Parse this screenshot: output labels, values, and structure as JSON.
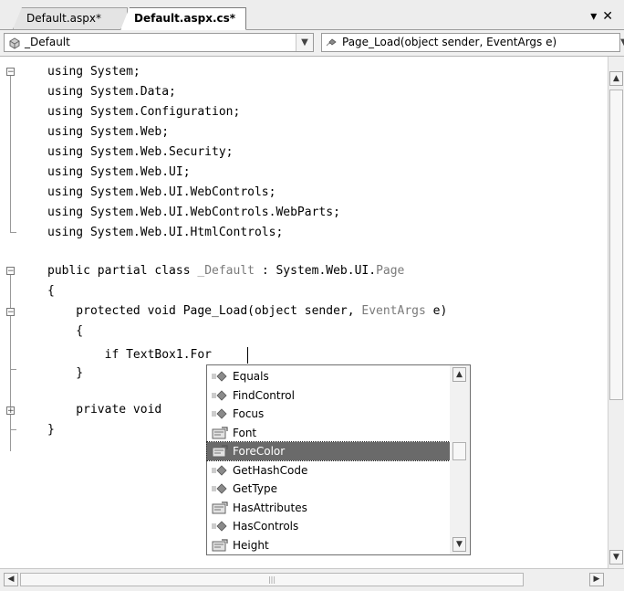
{
  "tabs": [
    {
      "label": "Default.aspx*",
      "active": false
    },
    {
      "label": "Default.aspx.cs*",
      "active": true
    }
  ],
  "tab_controls": {
    "dropdown_glyph": "▾",
    "close_glyph": "✕"
  },
  "navbar": {
    "class_combo": {
      "value": "_Default",
      "icon": "class-icon"
    },
    "member_combo": {
      "value": "Page_Load(object sender, EventArgs e)",
      "icon": "method-icon"
    }
  },
  "code": {
    "lines": [
      "using System;",
      "using System.Data;",
      "using System.Configuration;",
      "using System.Web;",
      "using System.Web.Security;",
      "using System.Web.UI;",
      "using System.Web.UI.WebControls;",
      "using System.Web.UI.WebControls.WebParts;",
      "using System.Web.UI.HtmlControls;",
      "",
      "public partial class _Default : System.Web.UI.Page",
      "{",
      "    protected void Page_Load(object sender, EventArgs e)",
      "    {",
      "        if TextBox1.For",
      "    }",
      "",
      "    private void",
      "}"
    ],
    "class_line": {
      "prefix": "public partial class ",
      "name": "_Default",
      "mid": " : System.Web.UI.",
      "base": "Page"
    },
    "method_line": {
      "prefix": "    protected void Page_Load(object sender, ",
      "type": "EventArgs",
      "suffix": " e)"
    },
    "type_color": "#7a7a7a"
  },
  "intellisense": {
    "items": [
      {
        "label": "Equals",
        "kind": "method-icon",
        "selected": false
      },
      {
        "label": "FindControl",
        "kind": "method-icon",
        "selected": false
      },
      {
        "label": "Focus",
        "kind": "method-icon",
        "selected": false
      },
      {
        "label": "Font",
        "kind": "property-icon",
        "selected": false
      },
      {
        "label": "ForeColor",
        "kind": "property-icon",
        "selected": true
      },
      {
        "label": "GetHashCode",
        "kind": "method-icon",
        "selected": false
      },
      {
        "label": "GetType",
        "kind": "method-icon",
        "selected": false
      },
      {
        "label": "HasAttributes",
        "kind": "property-icon",
        "selected": false
      },
      {
        "label": "HasControls",
        "kind": "method-icon",
        "selected": false
      },
      {
        "label": "Height",
        "kind": "property-icon",
        "selected": false
      }
    ],
    "selected_bg": "#6a6a6a"
  }
}
